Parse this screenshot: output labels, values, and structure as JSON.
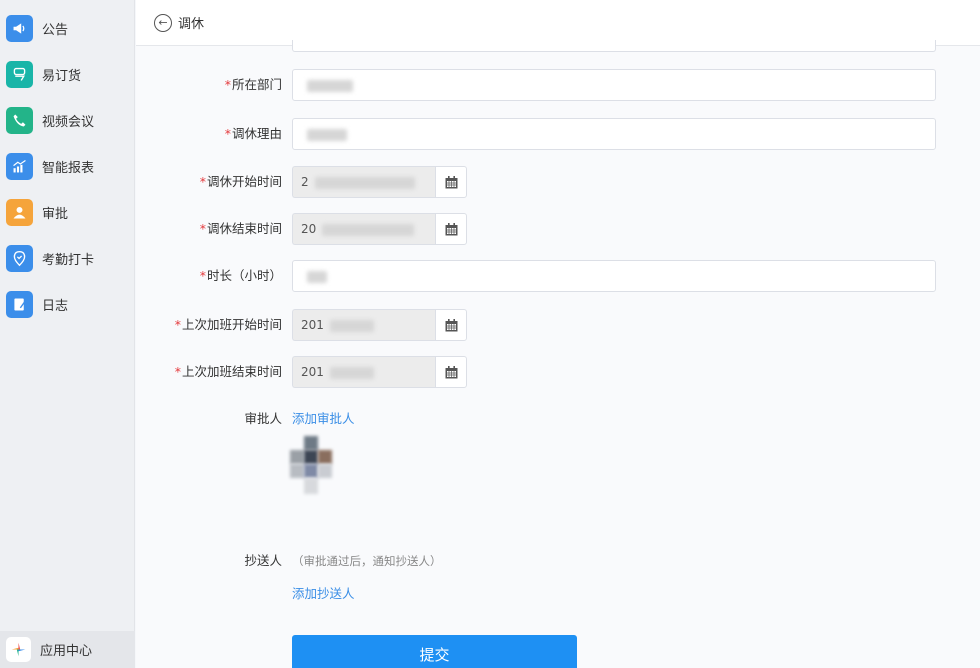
{
  "sidebar": {
    "items": [
      {
        "label": "公告",
        "icon": "megaphone-icon",
        "color": "#3b8eea"
      },
      {
        "label": "易订货",
        "icon": "yidinghuo-icon",
        "color": "#19b5a8"
      },
      {
        "label": "视频会议",
        "icon": "phone-icon",
        "color": "#23b489"
      },
      {
        "label": "智能报表",
        "icon": "chart-icon",
        "color": "#3b8eea"
      },
      {
        "label": "审批",
        "icon": "user-icon",
        "color": "#f5a43b"
      },
      {
        "label": "考勤打卡",
        "icon": "location-icon",
        "color": "#3b8eea"
      },
      {
        "label": "日志",
        "icon": "note-icon",
        "color": "#3b8eea"
      }
    ],
    "bottom": {
      "label": "应用中心",
      "icon": "app-center-icon"
    }
  },
  "header": {
    "title": "调休",
    "back": "back-icon"
  },
  "form": {
    "department": {
      "label": "所在部门",
      "required": "*",
      "value": ""
    },
    "reason": {
      "label": "调休理由",
      "required": "*",
      "value": ""
    },
    "start_time": {
      "label": "调休开始时间",
      "required": "*",
      "value": "2"
    },
    "end_time": {
      "label": "调休结束时间",
      "required": "*",
      "value": "20"
    },
    "duration": {
      "label": "时长（小时）",
      "required": "*",
      "value": ""
    },
    "ot_start": {
      "label": "上次加班开始时间",
      "required": "*",
      "value": "201"
    },
    "ot_end": {
      "label": "上次加班结束时间",
      "required": "*",
      "value": "201"
    },
    "approver": {
      "label": "审批人",
      "add_link": "添加审批人"
    },
    "cc": {
      "label": "抄送人",
      "hint": "（审批通过后，通知抄送人）",
      "add_link": "添加抄送人"
    },
    "submit_label": "提交"
  },
  "colors": {
    "accent": "#1e90f3",
    "link": "#3a8ee6",
    "required": "#e4393c"
  }
}
